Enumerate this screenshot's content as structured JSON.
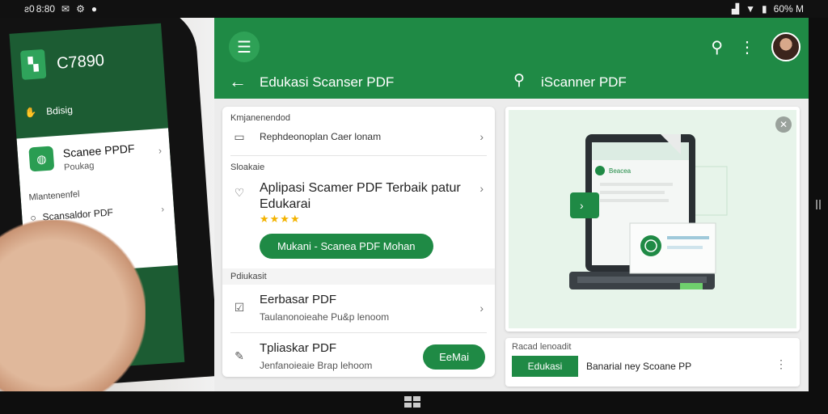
{
  "status": {
    "time": "8:80",
    "prefix": "ƨ0",
    "icons_left": [
      "message-icon",
      "gear-icon",
      "notification-icon"
    ],
    "battery": "60% M"
  },
  "phone": {
    "title": "C7890",
    "nav_label": "Bdisig",
    "app_title": "Scanee PPDF",
    "app_sub": "Poukag",
    "section": "Mlantenenfel",
    "item": "Scansaldor PDF"
  },
  "app": {
    "left_title": "Edukasi Scanser PDF",
    "right_title": "iScanner PDF",
    "sections": {
      "recommended": "Kmjanenendod",
      "stockaie": "Sloakaie",
      "edukasi": "Pdiukasit"
    },
    "row1": {
      "text": "Rephdeonoplan Caer lonam"
    },
    "featured": {
      "title": "Aplipasi Scamer PDF Terbaik patur Edukarai",
      "stars": "★★★★",
      "button": "Mukani - Scanea PDF Mohan"
    },
    "items": [
      {
        "title": "Eerbasar PDF",
        "sub": "Taulanonoieahe Pu&p lenoom"
      },
      {
        "title": "Tpliaskar PDF",
        "sub": "Jenfanoieaie Brap lehoom",
        "button": "EeMai"
      }
    ],
    "card": {
      "badge": "Beacea"
    },
    "bottom": {
      "label": "Racad lenoadit",
      "button": "Edukasi",
      "text": "Banarial ney Scoane PP"
    }
  },
  "colors": {
    "primary_green": "#1f8a45",
    "star": "#f3b300"
  }
}
